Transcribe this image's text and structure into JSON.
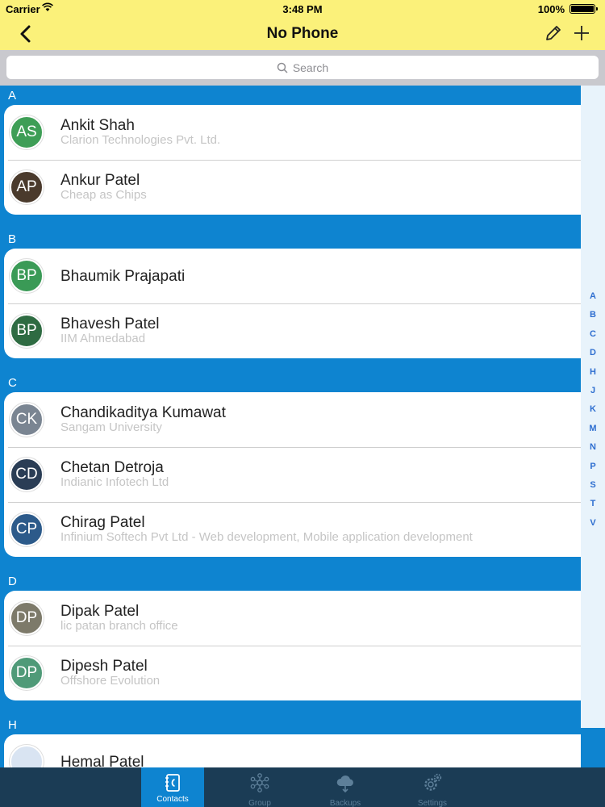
{
  "status": {
    "carrier": "Carrier",
    "time": "3:48 PM",
    "battery": "100%",
    "battery_level": 1.0
  },
  "nav": {
    "title": "No Phone"
  },
  "search": {
    "placeholder": "Search"
  },
  "sections": [
    {
      "letter": "A",
      "contacts": [
        {
          "initials": "AS",
          "name": "Ankit Shah",
          "subtitle": "Clarion Technologies Pvt. Ltd.",
          "color": "#3e9e56"
        },
        {
          "initials": "AP",
          "name": "Ankur Patel",
          "subtitle": "Cheap as Chips",
          "color": "#4a3a2c"
        }
      ]
    },
    {
      "letter": "B",
      "contacts": [
        {
          "initials": "BP",
          "name": "Bhaumik Prajapati",
          "subtitle": "",
          "color": "#3a9a56"
        },
        {
          "initials": "BP",
          "name": "Bhavesh Patel",
          "subtitle": "IIM Ahmedabad",
          "color": "#2e6b42"
        }
      ]
    },
    {
      "letter": "C",
      "contacts": [
        {
          "initials": "CK",
          "name": "Chandikaditya Kumawat",
          "subtitle": "Sangam University",
          "color": "#7a8592"
        },
        {
          "initials": "CD",
          "name": "Chetan Detroja",
          "subtitle": "Indianic Infotech Ltd",
          "color": "#2a3d55"
        },
        {
          "initials": "CP",
          "name": "Chirag Patel",
          "subtitle": "Infinium Softech Pvt Ltd - Web development, Mobile application development",
          "color": "#2c5a8a"
        }
      ]
    },
    {
      "letter": "D",
      "contacts": [
        {
          "initials": "DP",
          "name": "Dipak Patel",
          "subtitle": "lic patan branch office",
          "color": "#7d7a6a"
        },
        {
          "initials": "DP",
          "name": "Dipesh Patel",
          "subtitle": "Offshore Evolution",
          "color": "#4f9a78"
        }
      ]
    },
    {
      "letter": "H",
      "contacts": [
        {
          "initials": "",
          "name": "Hemal Patel",
          "subtitle": "",
          "color": "#d9e4f2"
        }
      ]
    }
  ],
  "index_letters": [
    "A",
    "B",
    "C",
    "D",
    "H",
    "J",
    "K",
    "M",
    "N",
    "P",
    "S",
    "T",
    "V"
  ],
  "tabs": [
    {
      "label": "Contacts",
      "icon": "contacts-icon",
      "active": true
    },
    {
      "label": "Group",
      "icon": "group-icon",
      "active": false
    },
    {
      "label": "Backups",
      "icon": "cloud-backup-icon",
      "active": false
    },
    {
      "label": "Settings",
      "icon": "gear-icon",
      "active": false
    }
  ]
}
